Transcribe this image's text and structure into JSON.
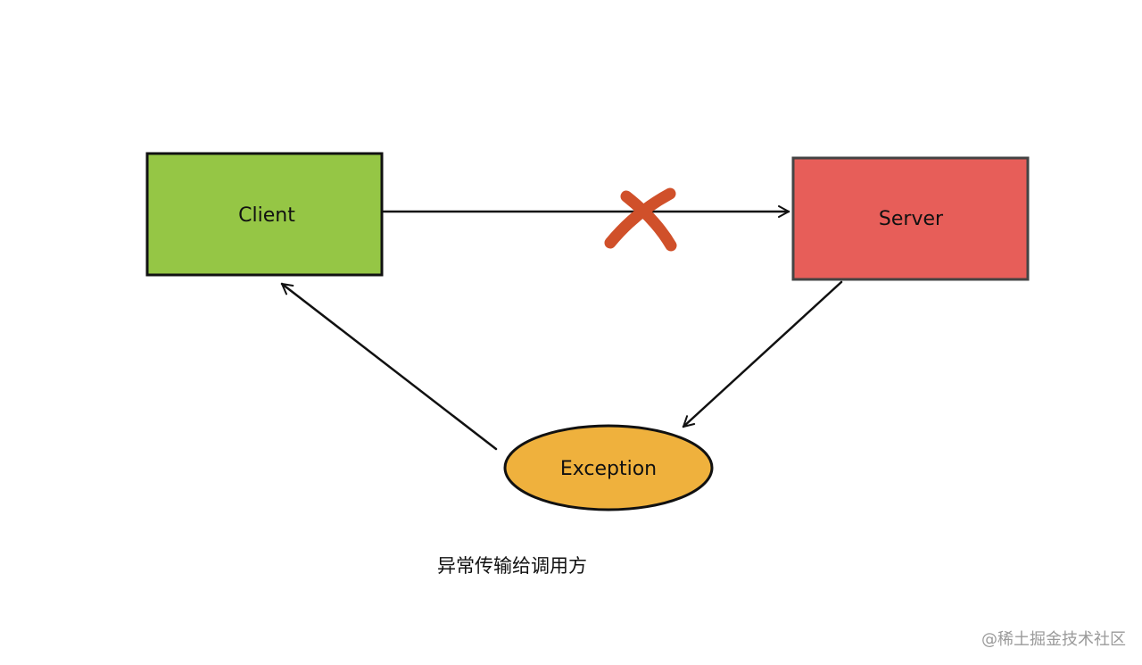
{
  "nodes": {
    "client": {
      "label": "Client",
      "fill": "#95C645",
      "stroke": "#111111"
    },
    "server": {
      "label": "Server",
      "fill": "#E75E59",
      "stroke": "#444444"
    },
    "exception": {
      "label": "Exception",
      "fill": "#EFB13D",
      "stroke": "#111111"
    }
  },
  "edges": [
    {
      "from": "client",
      "to": "server",
      "status": "failed"
    },
    {
      "from": "server",
      "to": "exception"
    },
    {
      "from": "exception",
      "to": "client"
    }
  ],
  "failure_marker": {
    "icon": "cross-icon",
    "color": "#D0502A"
  },
  "caption": "异常传输给调用方",
  "watermark": "@稀土掘金技术社区"
}
